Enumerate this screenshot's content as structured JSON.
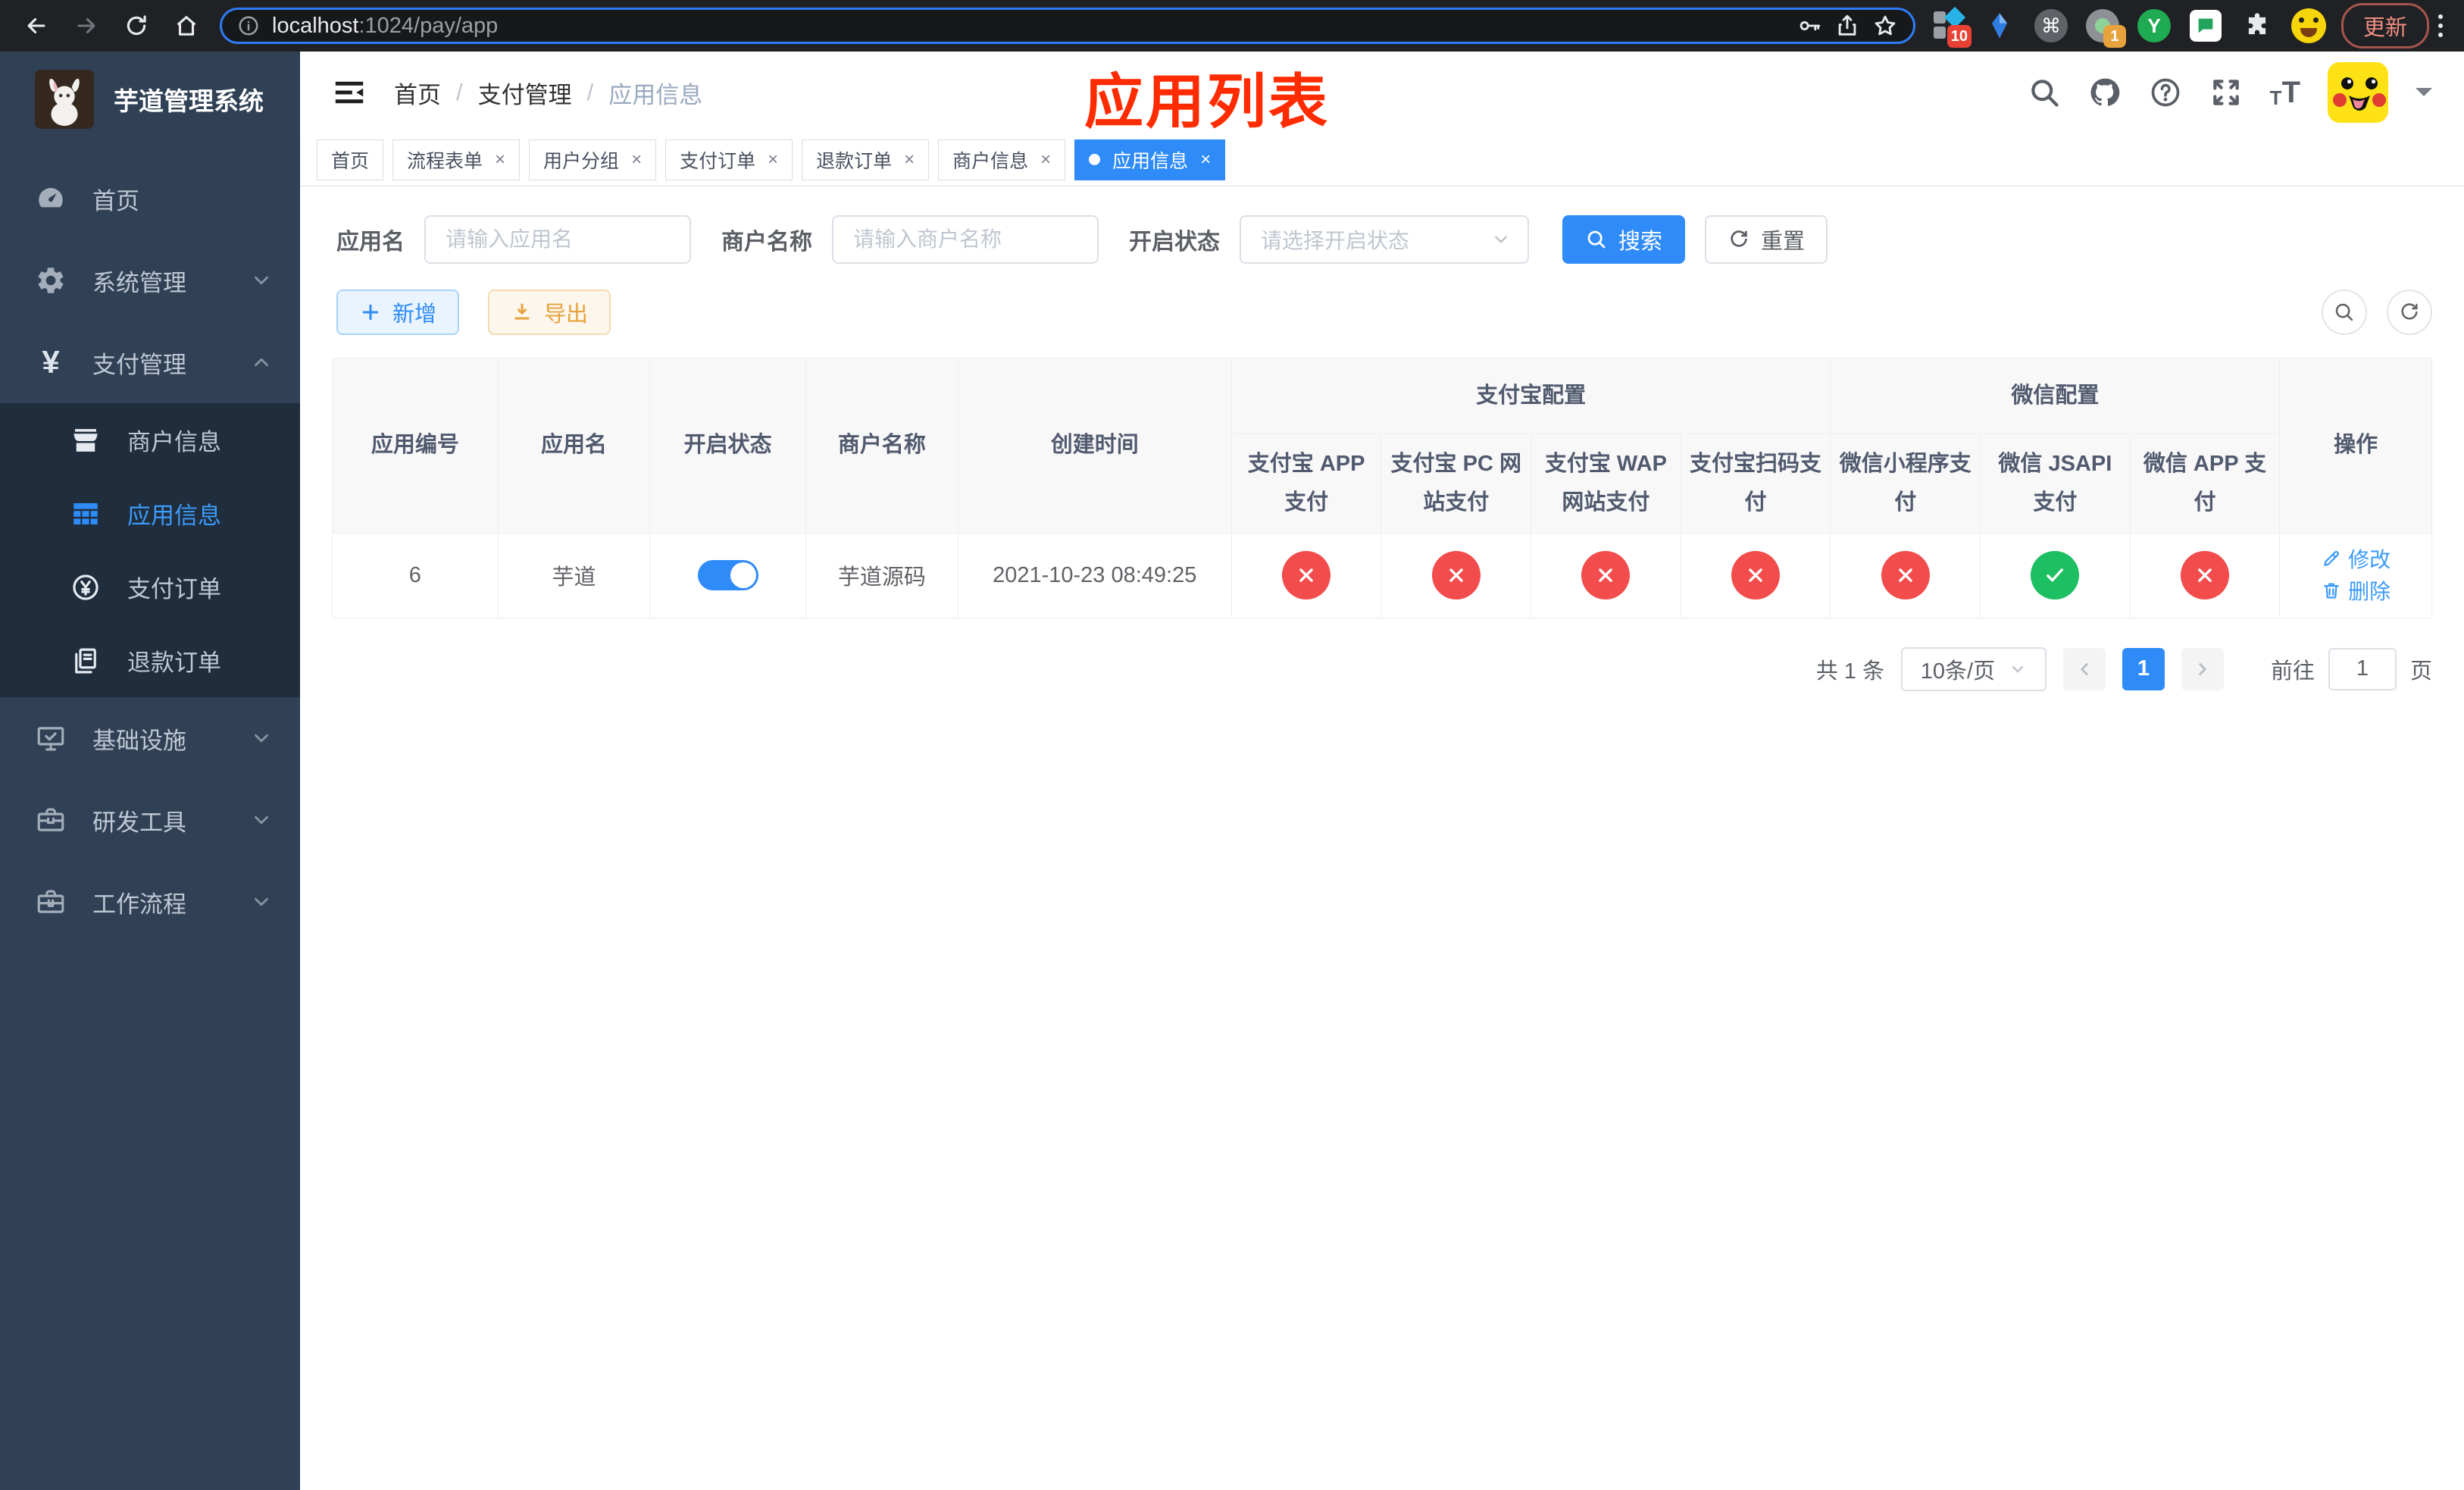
{
  "browser": {
    "url_host": "localhost",
    "url_rest": ":1024/pay/app",
    "ext_badge_blocks": "10",
    "ext_badge_camera": "1",
    "update_label": "更新"
  },
  "colors": {
    "primary": "#2e8bf7",
    "success": "#1dbf63",
    "danger": "#f34c4c",
    "warning": "#e6a23c",
    "sidebar_bg": "#304156",
    "sidebar_submenu_bg": "#1f2d3d",
    "annotation": "#ff2b01"
  },
  "sidebar": {
    "title": "芋道管理系统",
    "menu": [
      {
        "label": "首页",
        "icon": "dashboard",
        "type": "item"
      },
      {
        "label": "系统管理",
        "icon": "gear",
        "type": "submenu",
        "arrow": "down"
      },
      {
        "label": "支付管理",
        "icon": "yen",
        "type": "submenu",
        "arrow": "up",
        "open": true,
        "children": [
          {
            "label": "商户信息",
            "icon": "store"
          },
          {
            "label": "应用信息",
            "icon": "grid",
            "active": true
          },
          {
            "label": "支付订单",
            "icon": "coin"
          },
          {
            "label": "退款订单",
            "icon": "doc"
          }
        ]
      },
      {
        "label": "基础设施",
        "icon": "monitor",
        "type": "submenu",
        "arrow": "down"
      },
      {
        "label": "研发工具",
        "icon": "toolbox",
        "type": "submenu",
        "arrow": "down"
      },
      {
        "label": "工作流程",
        "icon": "briefcase",
        "type": "submenu",
        "arrow": "down"
      }
    ]
  },
  "navbar": {
    "breadcrumb": [
      "首页",
      "支付管理",
      "应用信息"
    ],
    "annotation": "应用列表"
  },
  "tabs": [
    {
      "label": "首页",
      "closable": false,
      "active": false
    },
    {
      "label": "流程表单",
      "closable": true,
      "active": false
    },
    {
      "label": "用户分组",
      "closable": true,
      "active": false
    },
    {
      "label": "支付订单",
      "closable": true,
      "active": false
    },
    {
      "label": "退款订单",
      "closable": true,
      "active": false
    },
    {
      "label": "商户信息",
      "closable": true,
      "active": false
    },
    {
      "label": "应用信息",
      "closable": true,
      "active": true
    }
  ],
  "filters": {
    "app_name_label": "应用名",
    "app_name_placeholder": "请输入应用名",
    "merchant_label": "商户名称",
    "merchant_placeholder": "请输入商户名称",
    "status_label": "开启状态",
    "status_placeholder": "请选择开启状态",
    "search_label": "搜索",
    "reset_label": "重置"
  },
  "toolbar": {
    "add_label": "新增",
    "export_label": "导出"
  },
  "table": {
    "columns": [
      "应用编号",
      "应用名",
      "开启状态",
      "商户名称",
      "创建时间"
    ],
    "groups": [
      {
        "label": "支付宝配置",
        "children": [
          "支付宝 APP 支付",
          "支付宝 PC 网站支付",
          "支付宝 WAP 网站支付",
          "支付宝扫码支付"
        ]
      },
      {
        "label": "微信配置",
        "children": [
          "微信小程序支付",
          "微信 JSAPI 支付",
          "微信 APP 支付"
        ]
      }
    ],
    "ops_label": "操作",
    "rows": [
      {
        "id": "6",
        "name": "芋道",
        "enabled": true,
        "merchant": "芋道源码",
        "created": "2021-10-23 08:49:25",
        "channels": [
          "no",
          "no",
          "no",
          "no",
          "no",
          "yes",
          "no"
        ],
        "edit_label": "修改",
        "delete_label": "删除"
      }
    ]
  },
  "pagination": {
    "total_label": "共 1 条",
    "page_size": "10条/页",
    "current_page": "1",
    "goto_label": "前往",
    "goto_value": "1",
    "page_label": "页"
  }
}
